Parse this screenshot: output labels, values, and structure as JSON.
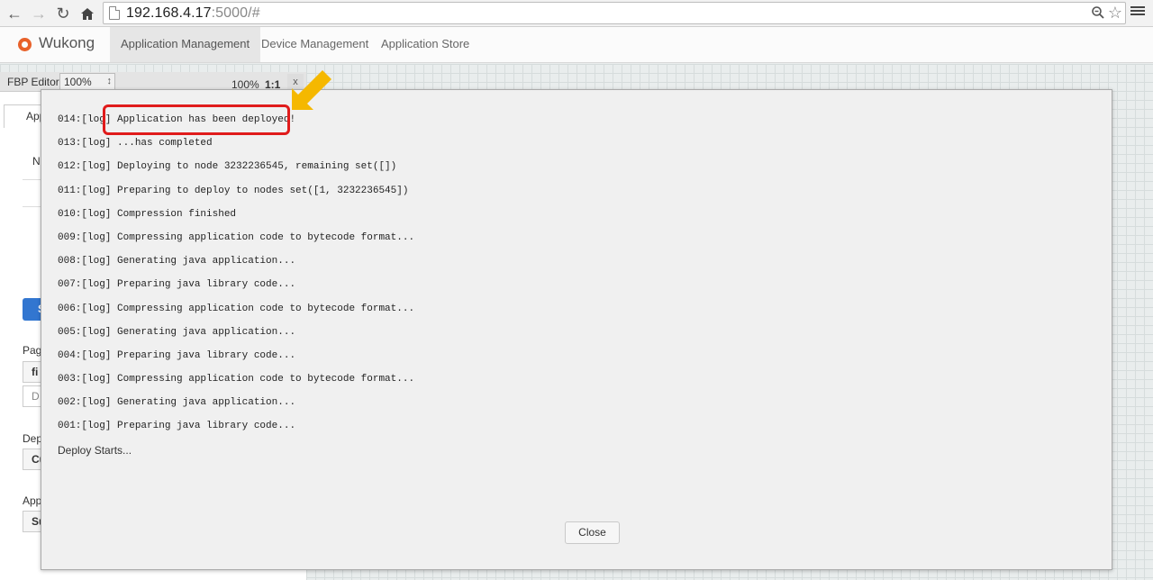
{
  "browser": {
    "url_host": "192.168.4.17",
    "url_rest": ":5000/#"
  },
  "app": {
    "brand": "Wukong",
    "tabs": [
      {
        "label": "Application Management",
        "active": true
      },
      {
        "label": "Device Management",
        "active": false
      },
      {
        "label": "Application Store",
        "active": false
      }
    ]
  },
  "fbp": {
    "label": "FBP Editor",
    "zoom_select": "100%",
    "zoom_text": "100%",
    "ratio": "1:1",
    "close": "x"
  },
  "left_panel": {
    "tab": "App",
    "name_label": "Na",
    "button_label": "S",
    "page_label": "Pag",
    "page_field": "fi",
    "page_sub": "D",
    "deploy_label": "Dep",
    "deploy_field": "Cu",
    "app_label": "App",
    "app_field": "Su"
  },
  "modal": {
    "logs": [
      "014:[log] Application has been deployed!",
      "013:[log] ...has completed",
      "012:[log] Deploying to node 3232236545, remaining set([])",
      "011:[log] Preparing to deploy to nodes set([1, 3232236545])",
      "010:[log] Compression finished",
      "009:[log] Compressing application code to bytecode format...",
      "008:[log] Generating java application...",
      "007:[log] Preparing java library code...",
      "006:[log] Compressing application code to bytecode format...",
      "005:[log] Generating java application...",
      "004:[log] Preparing java library code...",
      "003:[log] Compressing application code to bytecode format...",
      "002:[log] Generating java application...",
      "001:[log] Preparing java library code..."
    ],
    "deploy_start": "Deploy Starts...",
    "close_label": "Close"
  },
  "colors": {
    "highlight": "#e01b1b",
    "arrow": "#f5b800",
    "brand": "#e8612a"
  }
}
